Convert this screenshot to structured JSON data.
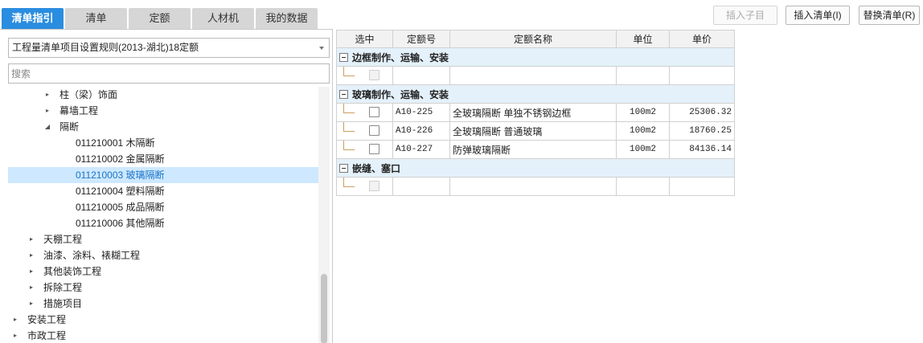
{
  "tabs": [
    {
      "label": "清单指引",
      "active": true
    },
    {
      "label": "清单",
      "active": false
    },
    {
      "label": "定额",
      "active": false
    },
    {
      "label": "人材机",
      "active": false
    },
    {
      "label": "我的数据",
      "active": false
    }
  ],
  "toolbar": {
    "insert_child": "插入子目",
    "insert_list": "插入清单(I)",
    "replace_list": "替换清单(R)"
  },
  "rule_select": {
    "value": "工程量清单项目设置规则(2013-湖北)18定额"
  },
  "search": {
    "placeholder": "搜索"
  },
  "tree": [
    {
      "label": "柱（梁）饰面",
      "arrow": "▸"
    },
    {
      "label": "幕墙工程",
      "arrow": "▸"
    },
    {
      "label": "隔断",
      "arrow": "◢"
    },
    {
      "label": "011210001  木隔断",
      "arrow": ""
    },
    {
      "label": "011210002  金属隔断",
      "arrow": ""
    },
    {
      "label": "011210003  玻璃隔断",
      "arrow": ""
    },
    {
      "label": "011210004  塑料隔断",
      "arrow": ""
    },
    {
      "label": "011210005  成品隔断",
      "arrow": ""
    },
    {
      "label": "011210006  其他隔断",
      "arrow": ""
    },
    {
      "label": "天棚工程",
      "arrow": "▸"
    },
    {
      "label": "油漆、涂料、裱糊工程",
      "arrow": "▸"
    },
    {
      "label": "其他装饰工程",
      "arrow": "▸"
    },
    {
      "label": "拆除工程",
      "arrow": "▸"
    },
    {
      "label": "措施项目",
      "arrow": "▸"
    },
    {
      "label": "安装工程",
      "arrow": "▸"
    },
    {
      "label": "市政工程",
      "arrow": "▸"
    }
  ],
  "grid": {
    "headers": [
      "选中",
      "定额号",
      "定额名称",
      "单位",
      "单价"
    ],
    "groups": [
      {
        "title": "边框制作、运输、安装",
        "rows": [
          {
            "code": "",
            "name": "",
            "unit": "",
            "price": ""
          }
        ]
      },
      {
        "title": "玻璃制作、运输、安装",
        "rows": [
          {
            "code": "A10-225",
            "name": "全玻璃隔断 单独不锈钢边框",
            "unit": "100m2",
            "price": "25306.32"
          },
          {
            "code": "A10-226",
            "name": "全玻璃隔断 普通玻璃",
            "unit": "100m2",
            "price": "18760.25"
          },
          {
            "code": "A10-227",
            "name": "防弹玻璃隔断",
            "unit": "100m2",
            "price": "84136.14"
          }
        ]
      },
      {
        "title": "嵌缝、塞口",
        "rows": [
          {
            "code": "",
            "name": "",
            "unit": "",
            "price": ""
          }
        ]
      }
    ]
  }
}
